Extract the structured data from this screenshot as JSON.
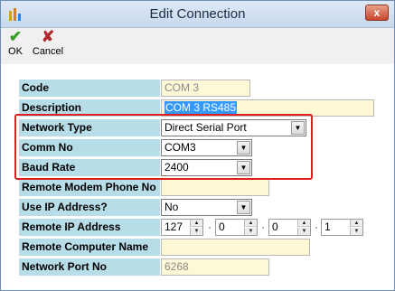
{
  "window": {
    "title": "Edit Connection"
  },
  "titlebar": {
    "close_glyph": "x"
  },
  "toolbar": {
    "ok": {
      "label": "OK",
      "icon": "check-icon",
      "glyph": "✔"
    },
    "cancel": {
      "label": "Cancel",
      "icon": "x-icon",
      "glyph": "✘"
    }
  },
  "form": {
    "code": {
      "label": "Code",
      "value": "COM 3"
    },
    "description": {
      "label": "Description",
      "value": "COM 3 RS485"
    },
    "network_type": {
      "label": "Network Type",
      "value": "Direct Serial Port"
    },
    "comm_no": {
      "label": "Comm No",
      "value": "COM3"
    },
    "baud_rate": {
      "label": "Baud Rate",
      "value": "2400"
    },
    "remote_modem_phone": {
      "label": "Remote Modem Phone No",
      "value": ""
    },
    "use_ip": {
      "label": "Use IP Address?",
      "value": "No"
    },
    "remote_ip": {
      "label": "Remote IP Address",
      "octets": [
        "127",
        "0",
        "0",
        "1"
      ],
      "separator": "·"
    },
    "remote_computer_name": {
      "label": "Remote Computer Name",
      "value": ""
    },
    "network_port": {
      "label": "Network Port No",
      "value": "6268"
    }
  },
  "colors": {
    "label_bg": "#b7dde8",
    "field_bg": "#fff8d4",
    "highlight": "#e02020",
    "selection": "#3399ff"
  }
}
